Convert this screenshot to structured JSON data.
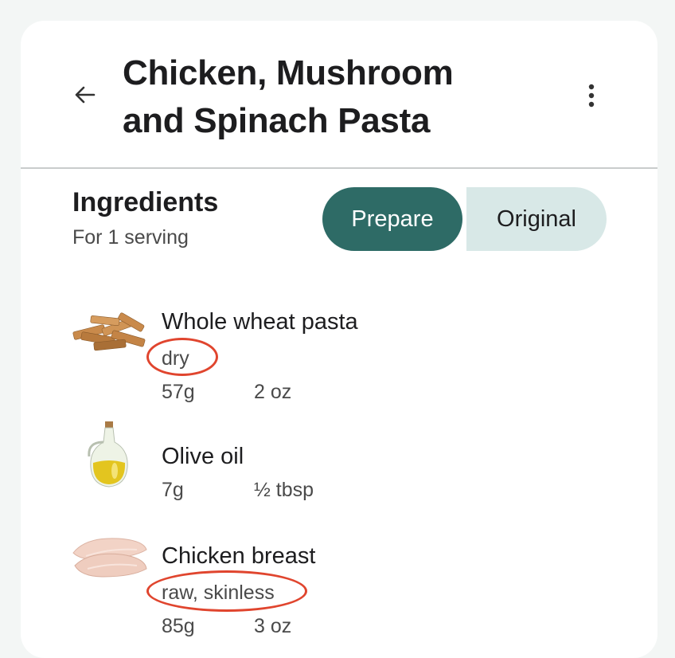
{
  "header": {
    "title_line1": "Chicken, Mushroom",
    "title_line2": "and Spinach Pasta",
    "back_icon": "arrow-left-icon",
    "more_icon": "more-vertical-icon"
  },
  "section": {
    "title": "Ingredients",
    "subtitle": "For 1 serving"
  },
  "toggle": {
    "options": [
      "Prepare",
      "Original"
    ],
    "selected": "Prepare"
  },
  "ingredients": [
    {
      "name": "Whole wheat pasta",
      "descriptor": "dry",
      "grams": "57g",
      "measure": "2 oz",
      "image": "penne-pasta-image",
      "descriptor_highlighted": true
    },
    {
      "name": "Olive oil",
      "descriptor": "",
      "grams": "7g",
      "measure": "½ tbsp",
      "image": "olive-oil-image",
      "descriptor_highlighted": false
    },
    {
      "name": "Chicken breast",
      "descriptor": "raw, skinless",
      "grams": "85g",
      "measure": "3 oz",
      "image": "chicken-breast-image",
      "descriptor_highlighted": true
    }
  ],
  "colors": {
    "accent": "#2e6b66",
    "accent_light": "#d8e8e7",
    "highlight_circle": "#e0452e",
    "background": "#f3f6f5"
  }
}
